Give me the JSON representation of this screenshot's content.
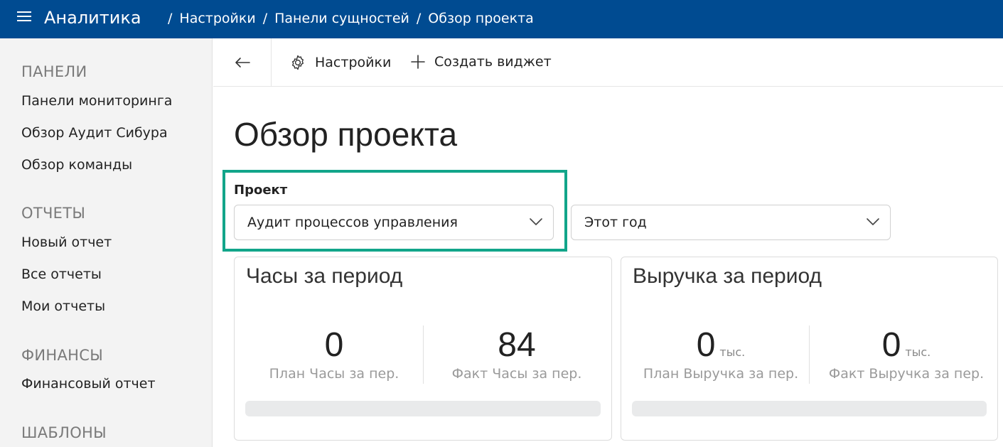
{
  "topbar": {
    "app_title": "Аналитика",
    "breadcrumb": [
      "Настройки",
      "Панели сущностей",
      "Обзор проекта"
    ],
    "bg": "#004b91"
  },
  "sidebar": {
    "sections": [
      {
        "title": "ПАНЕЛИ",
        "items": [
          "Панели мониторинга",
          "Обзор Аудит Сибура",
          "Обзор команды"
        ]
      },
      {
        "title": "ОТЧЕТЫ",
        "items": [
          "Новый отчет",
          "Все отчеты",
          "Мои отчеты"
        ]
      },
      {
        "title": "ФИНАНСЫ",
        "items": [
          "Финансовый отчет"
        ]
      },
      {
        "title": "ШАБЛОНЫ",
        "items": []
      }
    ]
  },
  "toolbar": {
    "back_icon": "arrow-left-icon",
    "settings_label": "Настройки",
    "create_widget_label": "Создать виджет"
  },
  "main": {
    "page_title": "Обзор проекта",
    "project_label": "Проект",
    "project_value": "Аудит процессов управления",
    "period_value": "Этот год",
    "highlight_color": "#12a58a"
  },
  "cards": [
    {
      "title": "Часы за период",
      "metrics": [
        {
          "value": "0",
          "unit": "",
          "caption": "План Часы за пер."
        },
        {
          "value": "84",
          "unit": "",
          "caption": "Факт Часы за пер."
        }
      ]
    },
    {
      "title": "Выручка за период",
      "metrics": [
        {
          "value": "0",
          "unit": "тыс.",
          "caption": "План Выручка за пер."
        },
        {
          "value": "0",
          "unit": "тыс.",
          "caption": "Факт Выручка за пер."
        }
      ]
    }
  ]
}
